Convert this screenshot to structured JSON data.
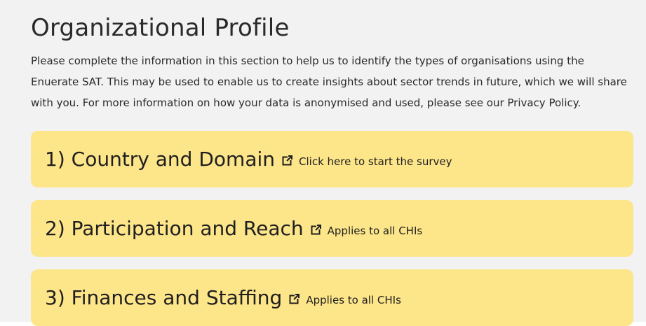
{
  "section": {
    "title": "Organizational Profile",
    "intro": "Please complete the information in this section to help us to identify the types of organisations using the Enuerate SAT. This may be used to enable us to create insights about sector trends in future, which we will share with you. For more information on how your data is anonymised and used, please see our Privacy Policy."
  },
  "cards": [
    {
      "title": "1) Country and Domain",
      "subtitle": "Click here to start the survey",
      "icon": "external-link-icon"
    },
    {
      "title": "2) Participation and Reach",
      "subtitle": "Applies to all CHIs",
      "icon": "external-link-icon"
    },
    {
      "title": "3) Finances and Staffing",
      "subtitle": "Applies to all CHIs",
      "icon": "external-link-icon"
    }
  ],
  "colors": {
    "card_background": "#fde58a",
    "page_background": "#f2f2f2"
  }
}
